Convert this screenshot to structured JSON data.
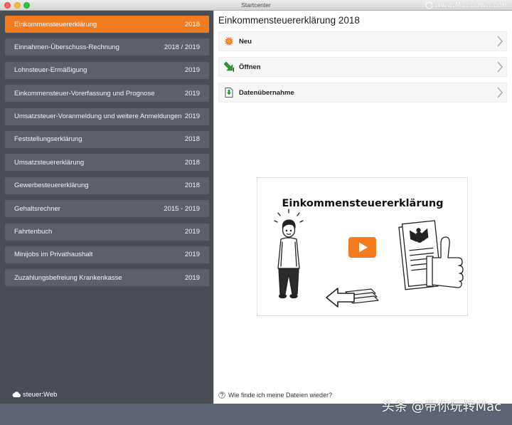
{
  "window": {
    "title": "Startcenter"
  },
  "watermarks": {
    "top": "www.MacDown.com",
    "bottom": "头条 @带你玩转Mac"
  },
  "colors": {
    "accent": "#f47c20",
    "sidebar_bg": "#484d56",
    "sidebar_item_bg": "#5c6169",
    "footer_bar": "#5d6475",
    "play_button": "#f47c20"
  },
  "sidebar": {
    "items": [
      {
        "label": "Einkommensteuererklärung",
        "year": "2018",
        "selected": true
      },
      {
        "label": "Einnahmen-Überschuss-Rechnung",
        "year": "2018 / 2019",
        "selected": false
      },
      {
        "label": "Lohnsteuer-Ermäßigung",
        "year": "2019",
        "selected": false
      },
      {
        "label": "Einkommensteuer-Vorerfassung und Prognose",
        "year": "2019",
        "selected": false
      },
      {
        "label": "Umsatzsteuer-Voranmeldung und weitere Anmeldungen",
        "year": "2019",
        "selected": false
      },
      {
        "label": "Feststellungserklärung",
        "year": "2018",
        "selected": false
      },
      {
        "label": "Umsatzsteuererklärung",
        "year": "2018",
        "selected": false
      },
      {
        "label": "Gewerbesteuererklärung",
        "year": "2018",
        "selected": false
      },
      {
        "label": "Gehaltsrechner",
        "year": "2015 - 2019",
        "selected": false
      },
      {
        "label": "Fahrtenbuch",
        "year": "2019",
        "selected": false
      },
      {
        "label": "Minijobs im Privathaushalt",
        "year": "2019",
        "selected": false
      },
      {
        "label": "Zuzahlungsbefreiung Krankenkasse",
        "year": "2019",
        "selected": false
      }
    ],
    "web_link": {
      "label": "steuer:Web",
      "icon": "cloud-icon"
    }
  },
  "main": {
    "title": "Einkommensteuererklärung 2018",
    "actions": [
      {
        "label": "Neu",
        "icon": "starburst-icon"
      },
      {
        "label": "Öffnen",
        "icon": "open-arrow-icon"
      },
      {
        "label": "Datenübernahme",
        "icon": "data-import-icon"
      }
    ],
    "video": {
      "heading": "Einkommensteuererklärung",
      "icon": "play-icon"
    },
    "help": {
      "label": "Wie finde ich meine Dateien wieder?",
      "icon": "help-icon"
    }
  }
}
